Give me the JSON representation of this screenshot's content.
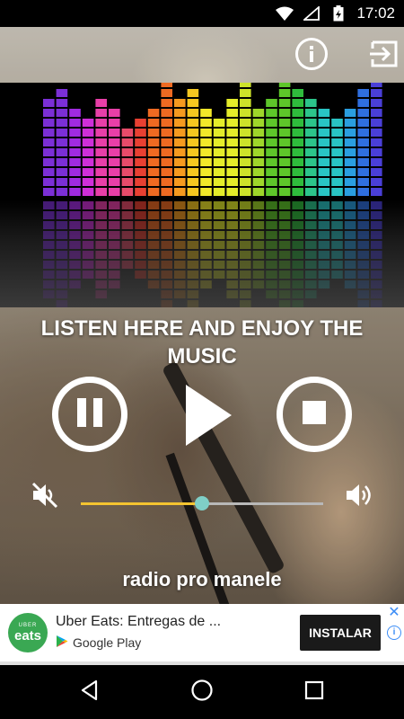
{
  "status_bar": {
    "time": "17:02",
    "icons": [
      "wifi-icon",
      "signal-icon",
      "battery-charging-icon"
    ]
  },
  "top_bar": {
    "icons": [
      "info-icon",
      "exit-icon"
    ]
  },
  "equalizer": {
    "icon": "equalizer-banner",
    "bar_levels": [
      0.77,
      0.85,
      0.69,
      0.62,
      0.77,
      0.69,
      0.54,
      0.62,
      0.69,
      0.92,
      0.77,
      0.85,
      0.69,
      0.62,
      0.77,
      0.92,
      0.69,
      0.77,
      0.92,
      0.85,
      0.77,
      0.69,
      0.62,
      0.69,
      0.85,
      0.92
    ],
    "colors": [
      "#7b2fd6",
      "#a02be0",
      "#cf2fd8",
      "#e83fa8",
      "#e84b6a",
      "#e84032",
      "#ef6a22",
      "#f59a1f",
      "#f5c720",
      "#f2e82a",
      "#e4ec2a",
      "#cde22a",
      "#9fd62a",
      "#5ec62a",
      "#2fbc3c",
      "#2cc48a",
      "#29c4c4",
      "#2a9ee0",
      "#2f6fe0",
      "#4a3fd8"
    ]
  },
  "title": "LISTEN HERE AND ENJOY THE MUSIC",
  "controls": {
    "icons": [
      "pause-icon",
      "play-icon",
      "stop-icon"
    ]
  },
  "volume": {
    "icons": [
      "volume-mute-icon",
      "volume-up-icon"
    ],
    "level": 0.5,
    "colors": {
      "fill": "#f4c430",
      "track": "#b8b8b8",
      "thumb": "#7fcfc7"
    }
  },
  "station_name": "radio pro manele",
  "ad": {
    "logo_top": "UBER",
    "logo_main": "eats",
    "title": "Uber Eats: Entregas de ...",
    "store": "Google Play",
    "install_label": "INSTALAR",
    "colors": {
      "logo": "#3aa853",
      "button": "#1a1a1a",
      "accent": "#3b8cf6"
    }
  },
  "nav_bar": {
    "icons": [
      "back-icon",
      "home-icon",
      "recents-icon"
    ]
  }
}
